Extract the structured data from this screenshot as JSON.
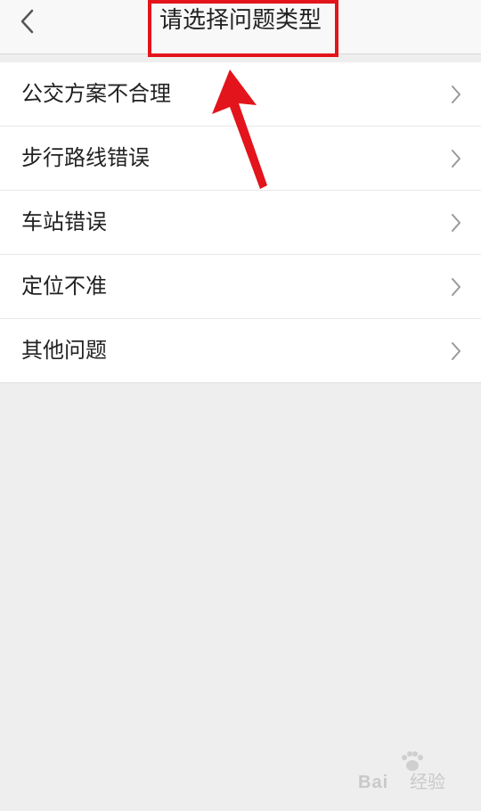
{
  "header": {
    "title": "请选择问题类型"
  },
  "list": {
    "items": [
      {
        "label": "公交方案不合理"
      },
      {
        "label": "步行路线错误"
      },
      {
        "label": "车站错误"
      },
      {
        "label": "定位不准"
      },
      {
        "label": "其他问题"
      }
    ]
  },
  "watermark": {
    "brand": "Bai",
    "brand_cn": "经验"
  },
  "colors": {
    "annotation_red": "#e3141b",
    "header_bg": "#f8f8f8",
    "page_bg": "#eeeeee"
  },
  "icons": {
    "back": "chevron-left-icon",
    "row": "chevron-right-icon",
    "annotation": "red-arrow-icon"
  }
}
